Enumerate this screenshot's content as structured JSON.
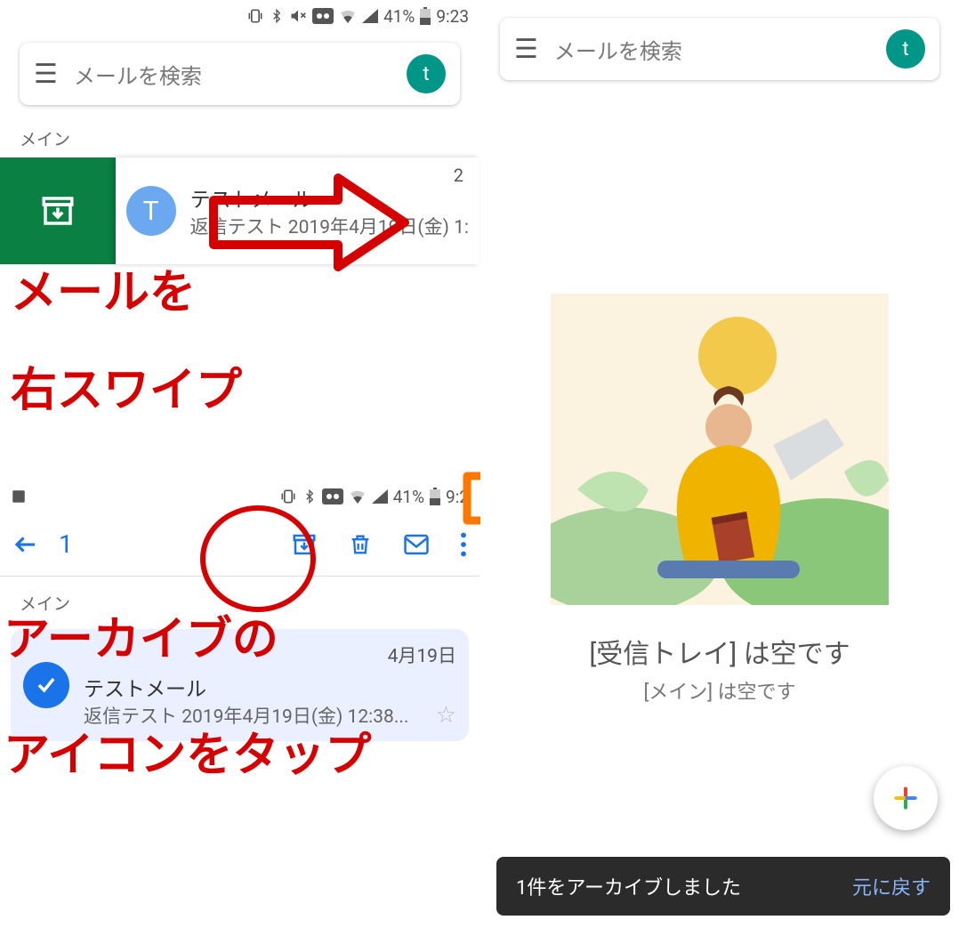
{
  "status": {
    "battery": "41%",
    "time": "9:23",
    "time2": "9:2"
  },
  "search": {
    "placeholder": "メールを検索",
    "avatar_letter": "t"
  },
  "section": {
    "main": "メイン"
  },
  "mail": {
    "avatar_letter": "T",
    "subject": "テストメール",
    "snippet": "返信テスト 2019年4月19日(金) 1:",
    "count": "2"
  },
  "annotate": {
    "swipe_line1": "メールを",
    "swipe_line2": "右スワイプ",
    "tap_line1": "アーカイブの",
    "tap_line2": "アイコンをタップ"
  },
  "selection": {
    "count": "1",
    "date": "4月19日",
    "subject": "テストメール",
    "snippet": "返信テスト 2019年4月19日(金) 12:38..."
  },
  "empty": {
    "title": "[受信トレイ] は空です",
    "subtitle": "[メイン] は空です"
  },
  "snackbar": {
    "message": "1件をアーカイブしました",
    "undo": "元に戻す"
  }
}
